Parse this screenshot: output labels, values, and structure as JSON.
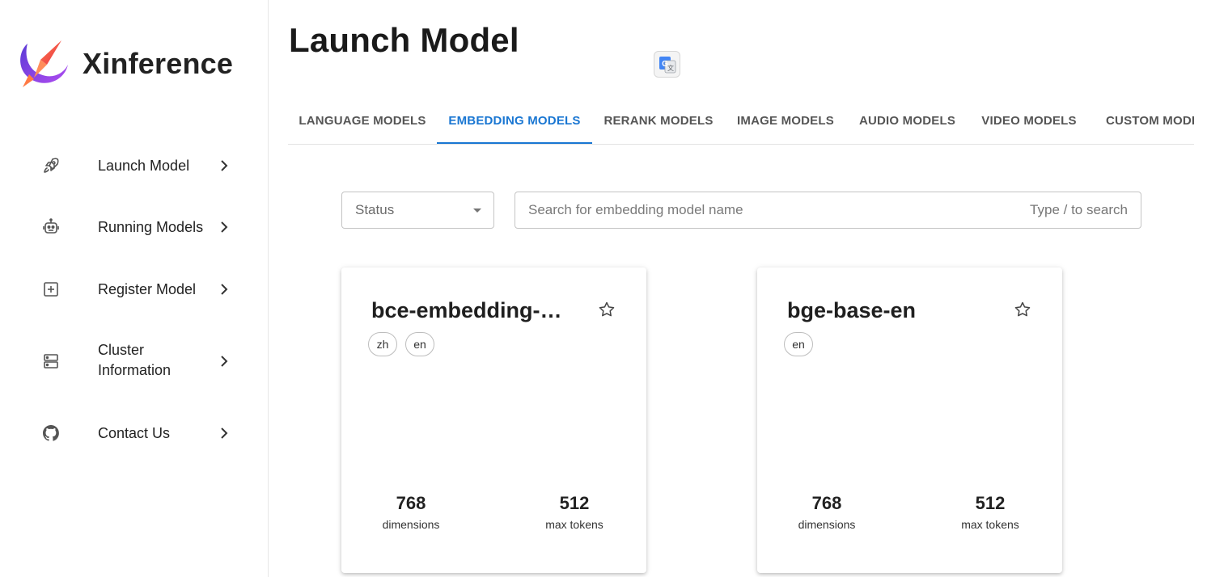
{
  "brand": {
    "name": "Xinference"
  },
  "sidebar": {
    "items": [
      {
        "label": "Launch Model",
        "icon": "rocket-icon"
      },
      {
        "label": "Running Models",
        "icon": "robot-icon"
      },
      {
        "label": "Register Model",
        "icon": "add-box-icon"
      },
      {
        "label": "Cluster Information",
        "icon": "server-icon"
      },
      {
        "label": "Contact Us",
        "icon": "github-icon"
      }
    ]
  },
  "page": {
    "title": "Launch Model"
  },
  "tabs": [
    {
      "label": "LANGUAGE MODELS",
      "active": false
    },
    {
      "label": "EMBEDDING MODELS",
      "active": true
    },
    {
      "label": "RERANK MODELS",
      "active": false
    },
    {
      "label": "IMAGE MODELS",
      "active": false
    },
    {
      "label": "AUDIO MODELS",
      "active": false
    },
    {
      "label": "VIDEO MODELS",
      "active": false
    },
    {
      "label": "CUSTOM MODE",
      "active": false
    }
  ],
  "filters": {
    "status_placeholder": "Status",
    "search_placeholder": "Search for embedding model name",
    "search_hint": "Type / to search"
  },
  "cards": [
    {
      "title": "bce-embedding-b···",
      "languages": [
        "zh",
        "en"
      ],
      "dimensions_value": "768",
      "dimensions_label": "dimensions",
      "max_tokens_value": "512",
      "max_tokens_label": "max tokens"
    },
    {
      "title": "bge-base-en",
      "languages": [
        "en"
      ],
      "dimensions_value": "768",
      "dimensions_label": "dimensions",
      "max_tokens_value": "512",
      "max_tokens_label": "max tokens"
    }
  ],
  "colors": {
    "accent": "#1976d2",
    "logo_purple": "#7b4ff0",
    "logo_orange": "#f26a3d"
  }
}
